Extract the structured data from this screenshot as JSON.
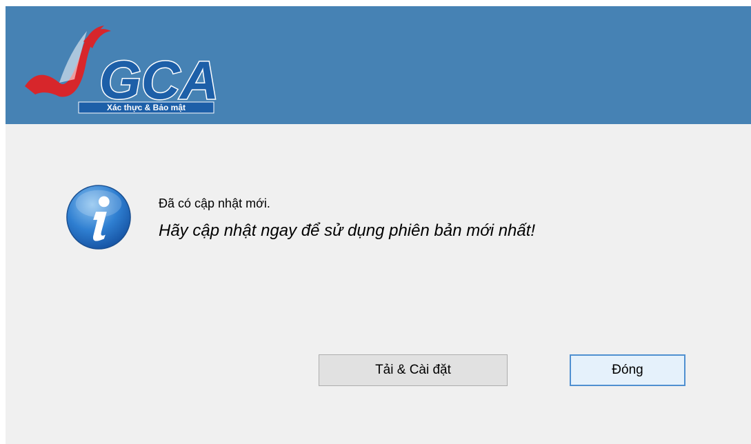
{
  "header": {
    "logo_text": "VGCA",
    "logo_tagline": "Xác thực & Bảo mật",
    "color": "#4682b4"
  },
  "message": {
    "icon": "info-icon",
    "line1": "Đã có cập nhật mới.",
    "line2": "Hãy cập nhật ngay để sử dụng phiên bản mới nhất!"
  },
  "buttons": {
    "install_label": "Tải & Cài đặt",
    "close_label": "Đóng"
  }
}
